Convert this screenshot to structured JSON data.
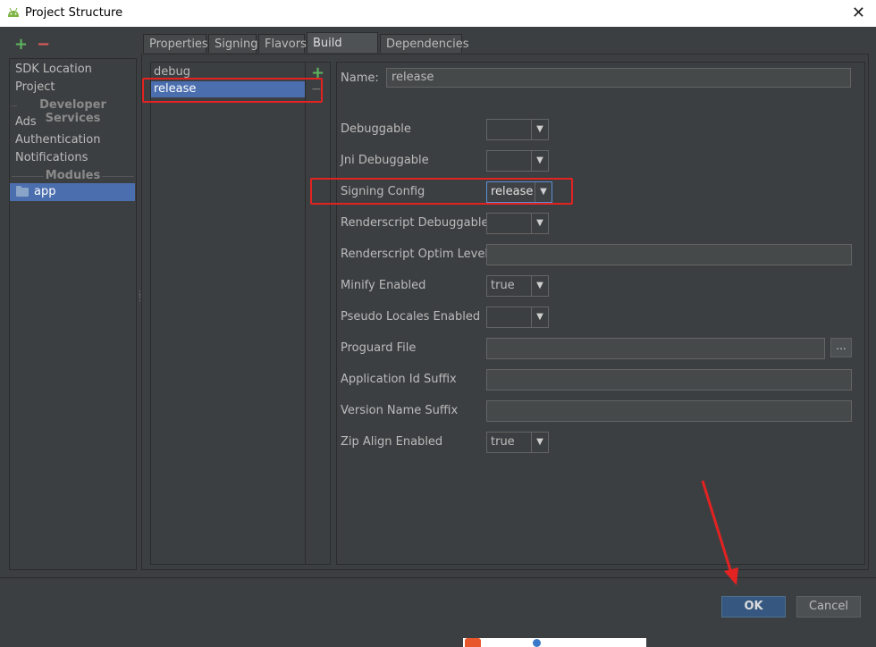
{
  "window": {
    "title": "Project Structure",
    "close_glyph": "✕",
    "app_icon": "android-icon"
  },
  "left_panel": {
    "add_glyph": "+",
    "remove_glyph": "−",
    "items": {
      "sdk_location": "SDK Location",
      "project": "Project",
      "developer_services_header": "Developer Services",
      "ads": "Ads",
      "authentication": "Authentication",
      "notifications": "Notifications",
      "modules_header": "Modules",
      "app": "app"
    },
    "selected": "app"
  },
  "tabs": {
    "properties": "Properties",
    "signing": "Signing",
    "flavors": "Flavors",
    "build_types": "Build Types",
    "dependencies": "Dependencies",
    "active": "Build Types"
  },
  "build_types": {
    "items": [
      "debug",
      "release"
    ],
    "selected": "release",
    "add_glyph": "+",
    "remove_glyph": "−"
  },
  "form": {
    "name_label": "Name:",
    "name_value": "release",
    "debuggable_label": "Debuggable",
    "debuggable_value": "",
    "jni_debuggable_label": "Jni Debuggable",
    "jni_debuggable_value": "",
    "signing_config_label": "Signing Config",
    "signing_config_value": "release",
    "renderscript_debuggable_label": "Renderscript Debuggable",
    "renderscript_debuggable_value": "",
    "renderscript_optim_label": "Renderscript Optim Level",
    "renderscript_optim_value": "",
    "minify_enabled_label": "Minify Enabled",
    "minify_enabled_value": "true",
    "pseudo_locales_label": "Pseudo Locales Enabled",
    "pseudo_locales_value": "",
    "proguard_file_label": "Proguard File",
    "proguard_file_value": "",
    "proguard_browse": "...",
    "app_id_suffix_label": "Application Id Suffix",
    "app_id_suffix_value": "",
    "version_name_suffix_label": "Version Name Suffix",
    "version_name_suffix_value": "",
    "zip_align_label": "Zip Align Enabled",
    "zip_align_value": "true",
    "dropdown_arrow": "▼"
  },
  "buttons": {
    "ok": "OK",
    "cancel": "Cancel"
  },
  "annotation_color": "#e32222",
  "accent_selection": "#4b6eaf"
}
